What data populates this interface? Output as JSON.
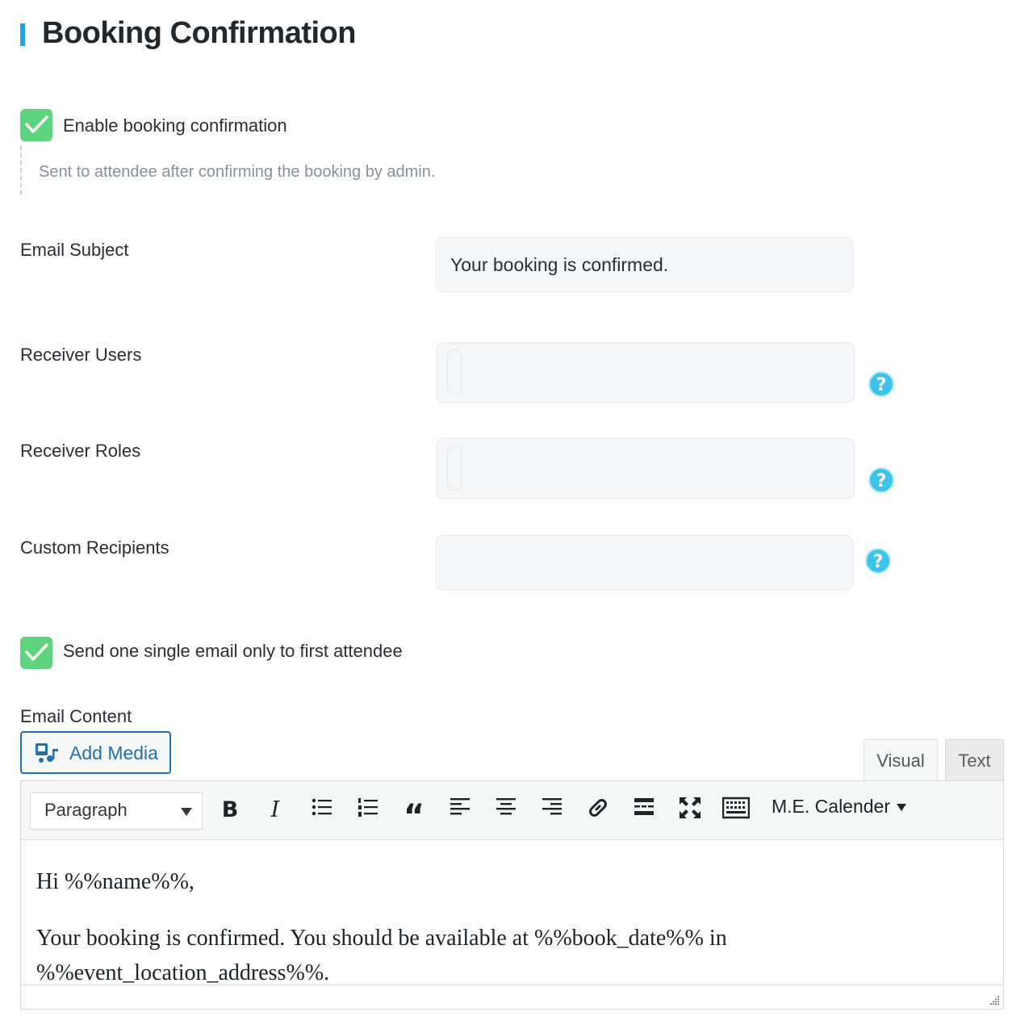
{
  "page": {
    "title": "Booking Confirmation"
  },
  "enable_confirmation": {
    "label": "Enable booking confirmation",
    "checked": true,
    "hint": "Sent to attendee after confirming the booking by admin."
  },
  "fields": {
    "email_subject": {
      "label": "Email Subject",
      "value": "Your booking is confirmed."
    },
    "receiver_users": {
      "label": "Receiver Users",
      "value": ""
    },
    "receiver_roles": {
      "label": "Receiver Roles",
      "value": ""
    },
    "custom_recipients": {
      "label": "Custom Recipients",
      "value": ""
    }
  },
  "single_email": {
    "label": "Send one single email only to first attendee",
    "checked": true
  },
  "email_content": {
    "label": "Email Content",
    "add_media_label": "Add Media",
    "tabs": {
      "visual": "Visual",
      "text": "Text"
    },
    "format_select": "Paragraph",
    "me_calendar_label": "M.E. Calender",
    "toolbar_glyphs": {
      "bold": "B",
      "italic": "I",
      "quote": "“"
    },
    "body": {
      "greeting": "Hi %%name%%,",
      "line1": "Your booking is confirmed. You should be available at %%book_date%% in",
      "line2": "%%event_location_address%%."
    }
  },
  "colors": {
    "accent_bar": "#1fa4e4",
    "checkbox": "#5fd47e",
    "help_icon": "#3dc4ec",
    "link_blue": "#2271b1"
  },
  "icons": {
    "help": "question-icon",
    "check": "check-icon",
    "media": "media-icon"
  },
  "help_glyph": "?"
}
